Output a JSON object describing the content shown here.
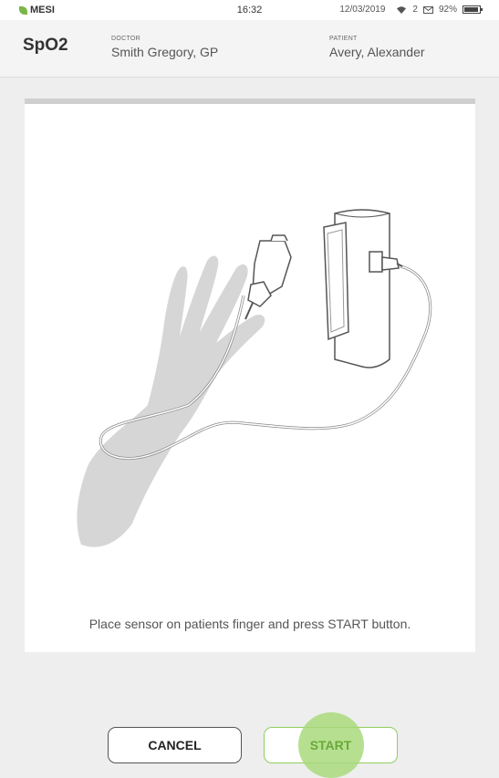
{
  "status_bar": {
    "brand": "MESI",
    "time": "16:32",
    "date": "12/03/2019",
    "mail_count": "2",
    "battery": "92%",
    "battery_level": 0.92
  },
  "header": {
    "title": "SpO2",
    "doctor_label": "DOCTOR",
    "doctor_value": "Smith Gregory, GP",
    "patient_label": "PATIENT",
    "patient_value": "Avery, Alexander"
  },
  "instruction": "Place sensor on patients finger and press START button.",
  "buttons": {
    "cancel": "CANCEL",
    "start": "START"
  },
  "colors": {
    "accent": "#8fce5c",
    "background": "#eeeeee"
  }
}
